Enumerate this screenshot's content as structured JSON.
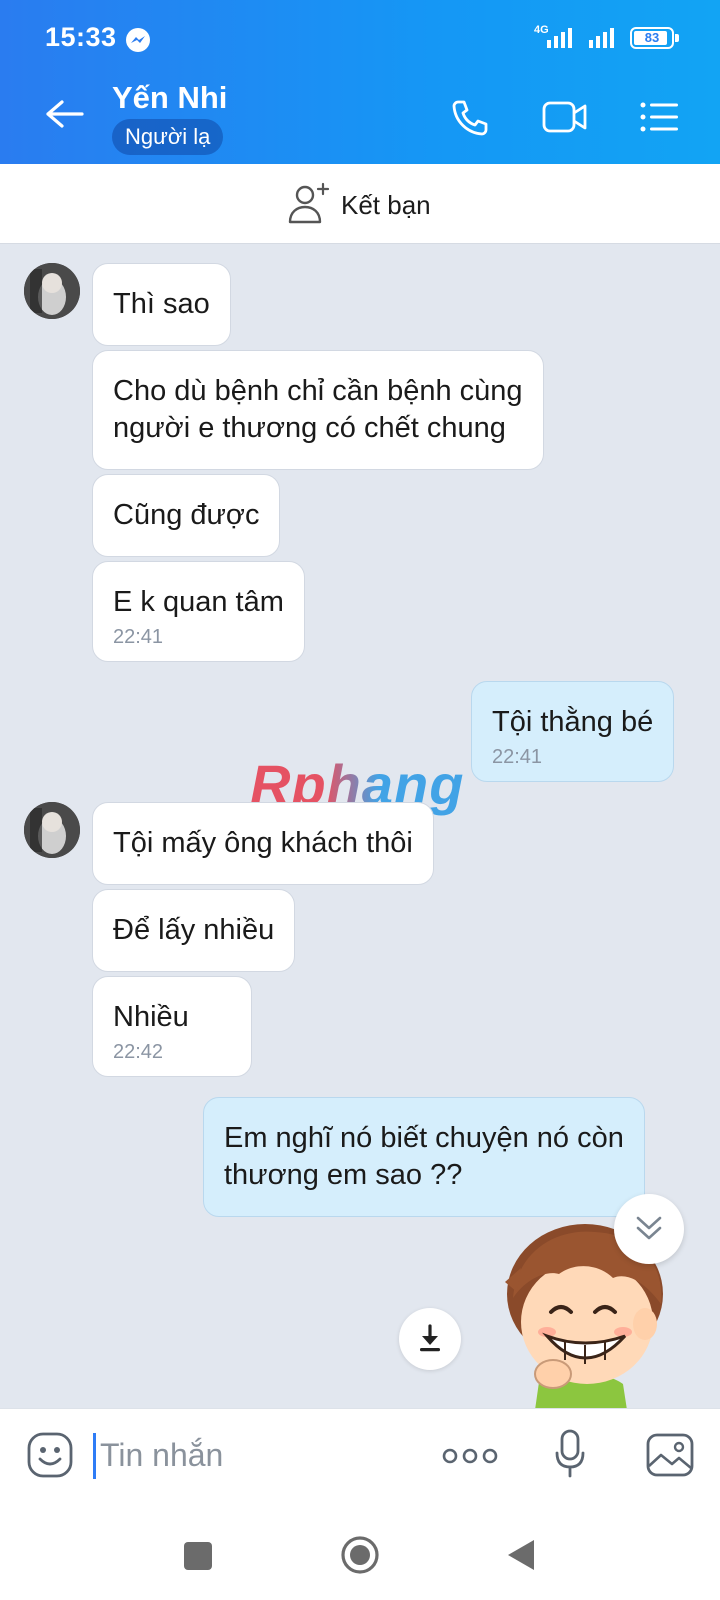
{
  "status_bar": {
    "time": "15:33",
    "network": "4G",
    "battery": "83"
  },
  "header": {
    "name": "Yến Nhi",
    "badge": "Người lạ"
  },
  "friend_bar": {
    "label": "Kết bạn"
  },
  "watermark": "Rphang",
  "messages": [
    {
      "direction": "in",
      "text": "Thì sao"
    },
    {
      "direction": "in",
      "lines": [
        "Cho dù bệnh chỉ cần bệnh cùng",
        "người e thương có chết chung"
      ]
    },
    {
      "direction": "in",
      "text": "Cũng được"
    },
    {
      "direction": "in",
      "text": "E k quan tâm",
      "time": "22:41"
    },
    {
      "direction": "out",
      "text": "Tội thằng bé",
      "time": "22:41"
    },
    {
      "direction": "in",
      "text": "Tội mấy ông khách thôi"
    },
    {
      "direction": "in",
      "text": "Để lấy nhiều"
    },
    {
      "direction": "in",
      "text": "Nhiều",
      "time": "22:42"
    },
    {
      "direction": "out",
      "lines": [
        "Em nghĩ nó biết chuyện nó còn",
        "thương em sao ??"
      ]
    }
  ],
  "input": {
    "placeholder": "Tin nhắn",
    "value": ""
  },
  "colors": {
    "header_start": "#2a7cf0",
    "header_end": "#12a4f4",
    "chat_bg": "#e2e7ef",
    "outgoing_bubble": "#d5eefc"
  },
  "icons": [
    "back-arrow-icon",
    "phone-icon",
    "video-call-icon",
    "menu-icon",
    "add-friend-icon",
    "emoji-icon",
    "more-icon",
    "microphone-icon",
    "image-icon",
    "download-icon",
    "chevron-double-down-icon"
  ]
}
